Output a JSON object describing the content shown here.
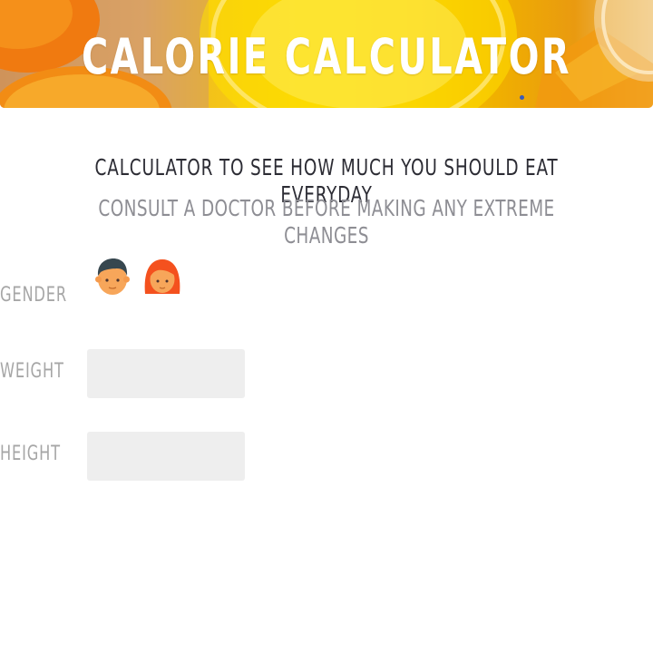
{
  "header": {
    "title": "CALORIE CALCULATOR"
  },
  "intro": {
    "subtitle": "CALCULATOR TO SEE HOW MUCH YOU SHOULD EAT EVERYDAY",
    "warning": "CONSULT A DOCTOR BEFORE MAKING ANY EXTREME CHANGES"
  },
  "form": {
    "gender": {
      "label": "GENDER",
      "options": [
        {
          "icon": "male-avatar-icon"
        },
        {
          "icon": "female-avatar-icon"
        }
      ]
    },
    "weight": {
      "label": "WEIGHT",
      "value": "",
      "placeholder": ""
    },
    "height": {
      "label": "HEIGHT",
      "value": "",
      "placeholder": ""
    }
  },
  "colors": {
    "title_text": "#ffffff",
    "subtitle_text": "#2c2c34",
    "muted_text": "#8e8e94",
    "label_text": "#a6a6a6",
    "field_bg": "#eeeeee",
    "banner_yellow": "#f9d600",
    "banner_orange": "#f08a00"
  }
}
